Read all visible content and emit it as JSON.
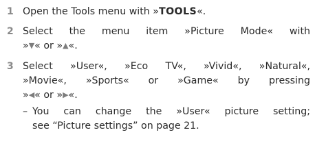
{
  "colors": {
    "number": "#8a8a8a",
    "text": "#2a2a2a",
    "arrow": "#7d7d7d"
  },
  "steps": [
    {
      "number": "1",
      "pre": "Open the Tools menu with »",
      "key": "TOOLS",
      "post": "«."
    },
    {
      "number": "2",
      "line1": "Select the menu item »Picture Mode« with",
      "pre": "»",
      "arrow_down": "▼",
      "mid": "« or »",
      "arrow_up": "▲",
      "post": "«."
    },
    {
      "number": "3",
      "line1": "Select »User«, »Eco TV«, »Vivid«, »Natural«,",
      "line2": "»Movie«, »Sports« or »Game« by pressing",
      "pre": "»",
      "arrow_left": "◀",
      "mid": "« or »",
      "arrow_right": "▶",
      "post": "«.",
      "sub": {
        "dash": "–",
        "line1": "You can change the »User« picture setting;",
        "line2": "see “Picture settings” on page  21."
      }
    }
  ]
}
